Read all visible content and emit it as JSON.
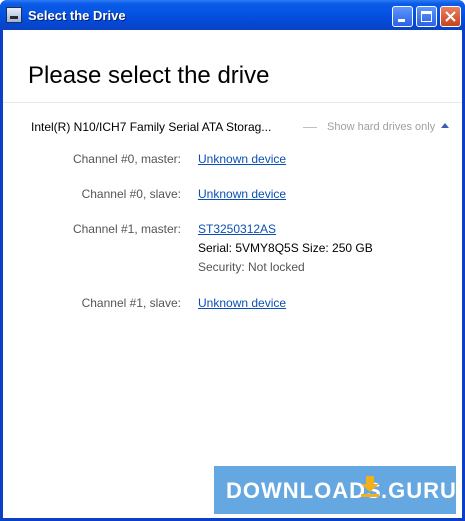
{
  "window": {
    "title": "Select the Drive"
  },
  "heading": "Please select the drive",
  "controller": {
    "name": "Intel(R) N10/ICH7 Family Serial ATA Storag...",
    "toggle_label": "Show hard drives only"
  },
  "channels": [
    {
      "label": "Channel #0, master:",
      "device": "Unknown device"
    },
    {
      "label": "Channel #0, slave:",
      "device": "Unknown device"
    },
    {
      "label": "Channel #1, master:",
      "device": "ST3250312AS",
      "serial_line": "Serial: 5VMY8Q5S   Size: 250 GB",
      "security": "Security: Not locked"
    },
    {
      "label": "Channel #1, slave:",
      "device": "Unknown device"
    }
  ],
  "watermark": {
    "left": "DOWNLOADS",
    "right": ".GURU"
  },
  "colors": {
    "title_bar": "#0553e2",
    "link": "#0b4fb4",
    "label": "#555555",
    "hint": "#a0a0a0",
    "watermark": "#3a8ed8"
  }
}
